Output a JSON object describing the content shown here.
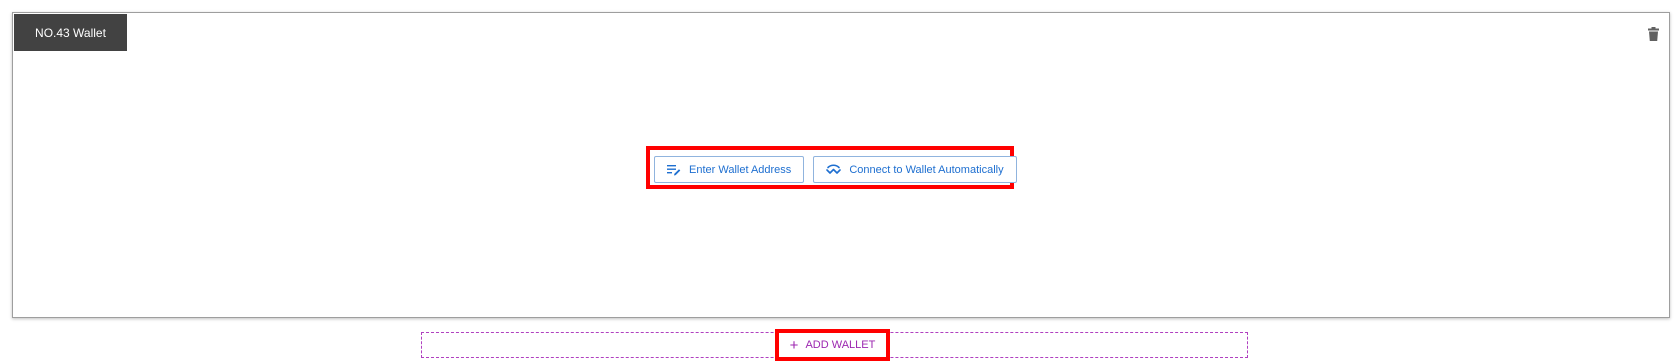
{
  "wallet_card": {
    "title": "NO.43 Wallet",
    "delete_icon": "trash-icon",
    "actions": {
      "enter_address_label": "Enter Wallet Address",
      "enter_address_icon": "edit-list-icon",
      "connect_auto_label": "Connect to Wallet Automatically",
      "connect_auto_icon": "walletconnect-icon"
    }
  },
  "add_wallet": {
    "label": "ADD WALLET",
    "icon": "plus-icon"
  },
  "colors": {
    "tab_bg": "#424242",
    "button_text": "#1e6fd0",
    "add_wallet": "#9c27b0",
    "highlight": "#ff0000"
  }
}
